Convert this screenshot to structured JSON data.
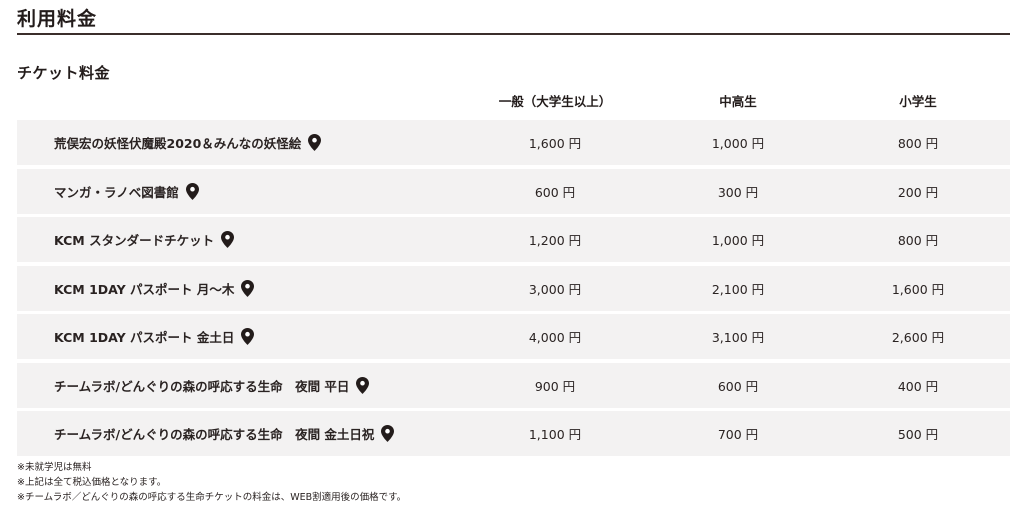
{
  "page": {
    "title": "利用料金"
  },
  "section": {
    "title": "チケット料金"
  },
  "columns": {
    "general": "一般（大学生以上）",
    "middle": "中高生",
    "elementary": "小学生"
  },
  "rows": [
    {
      "name": "荒俣宏の妖怪伏魔殿2020＆みんなの妖怪絵",
      "general": "1,600 円",
      "middle": "1,000 円",
      "elementary": "800 円"
    },
    {
      "name": "マンガ・ラノベ図書館",
      "general": "600 円",
      "middle": "300 円",
      "elementary": "200 円"
    },
    {
      "name": "KCM スタンダードチケット",
      "general": "1,200 円",
      "middle": "1,000 円",
      "elementary": "800 円"
    },
    {
      "name": "KCM 1DAY パスポート 月～木",
      "general": "3,000 円",
      "middle": "2,100 円",
      "elementary": "1,600 円"
    },
    {
      "name": "KCM 1DAY パスポート 金土日",
      "general": "4,000 円",
      "middle": "3,100 円",
      "elementary": "2,600 円"
    },
    {
      "name": "チームラボ/どんぐりの森の呼応する生命　夜間 平日",
      "general": "900 円",
      "middle": "600 円",
      "elementary": "400 円"
    },
    {
      "name": "チームラボ/どんぐりの森の呼応する生命　夜間 金土日祝",
      "general": "1,100 円",
      "middle": "700 円",
      "elementary": "500 円"
    }
  ],
  "notes": [
    "※未就学児は無料",
    "※上記は全て税込価格となります。",
    "※チームラボ／どんぐりの森の呼応する生命チケットの料金は、WEB割適用後の価格です。"
  ],
  "icons": {
    "location": "map-pin-icon"
  },
  "colors": {
    "row_background": "#f3f2f2",
    "rule": "#3b2e2b",
    "text": "#2a2322"
  }
}
